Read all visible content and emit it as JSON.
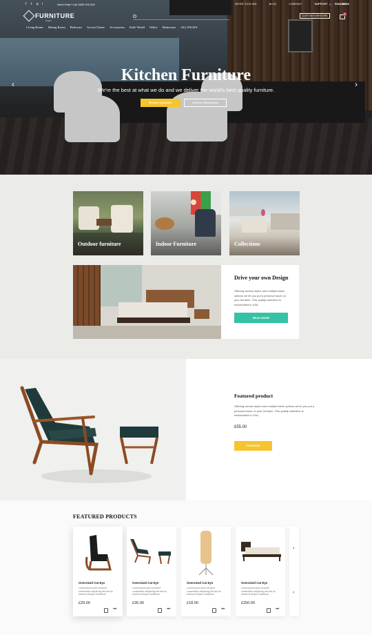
{
  "topbar": {
    "social": [
      "f",
      "t",
      "p",
      "i"
    ],
    "phone": "Need Help? Call 0800 000 000",
    "links": [
      "WE'RE COOLING",
      "BLOG",
      "COMPANY",
      "SUPPORT",
      "LOGIN"
    ],
    "language": "ENGLISH"
  },
  "header": {
    "logo_name": "FURNITURE",
    "logo_tag": "Studio",
    "search_placeholder": "",
    "custom_button": "CUSTOM FURNITURE",
    "cart_count": "0"
  },
  "nav": [
    "Living Room",
    "Dining Room",
    "Bedroom",
    "Accent Chairs",
    "Accessories",
    "Kids' World",
    "Office",
    "Mattresses",
    "ALL PAGES"
  ],
  "hero": {
    "title": "Kitchen Furniture",
    "subtitle": "We're the best at what we do and we deliver the world's best quality furniture.",
    "primary_button": "Browse Collection",
    "secondary_button": "Visit our Showrooms"
  },
  "categories": [
    "Outdoor furniture",
    "Indoor Furniture",
    "Collections"
  ],
  "design_block": {
    "title": "Drive your own Design",
    "text": "Offering various styles and multiple fabric options we let you put a personal touch on your furniture. This quality collection is handcrafted in USA.",
    "button": "READ MORE"
  },
  "featured": {
    "title": "Featured product",
    "text": "Offering various styles and multiple fabric options we let you put a personal touch on your furniture. This quality collection is handcrafted in USA.",
    "price": "£55.00",
    "button": "PURCHASE"
  },
  "products": {
    "title": "FEATURED PRODUCTS",
    "items": [
      {
        "name": "Oversized Cat Eye",
        "desc": "Lorem ipsum dolor sit amet consectetur adipiscing elit sed do eiusmod tempor incididunt",
        "price": "£29.00"
      },
      {
        "name": "Oversized Cat Eye",
        "desc": "Lorem ipsum dolor sit amet consectetur adipiscing elit sed do eiusmod tempor incididunt",
        "price": "£35.00"
      },
      {
        "name": "Oversized Cat Eye",
        "desc": "Lorem ipsum dolor sit amet consectetur adipiscing elit sed do eiusmod tempor incididunt",
        "price": "£18.00"
      },
      {
        "name": "Oversized Cat Eye",
        "desc": "Lorem ipsum dolor sit amet consectetur adipiscing elit sed do eiusmod tempor incididunt",
        "price": "£250.00"
      }
    ]
  },
  "colors": {
    "accent_yellow": "#f6c42d",
    "accent_teal": "#35c2a5",
    "cart_badge": "#e34b5c"
  }
}
